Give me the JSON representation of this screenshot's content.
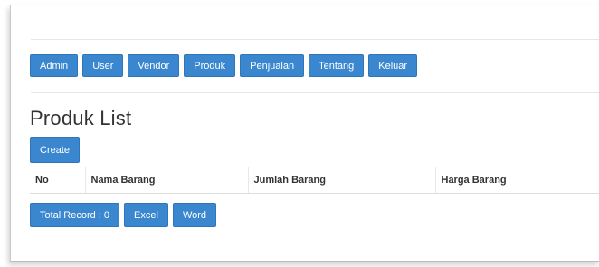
{
  "nav": {
    "items": [
      {
        "label": "Admin"
      },
      {
        "label": "User"
      },
      {
        "label": "Vendor"
      },
      {
        "label": "Produk"
      },
      {
        "label": "Penjualan"
      },
      {
        "label": "Tentang"
      },
      {
        "label": "Keluar"
      }
    ]
  },
  "page": {
    "title": "Produk List",
    "create_label": "Create"
  },
  "table": {
    "columns": [
      "No",
      "Nama Barang",
      "Jumlah Barang",
      "Harga Barang"
    ]
  },
  "footer": {
    "total_record_label": "Total Record : 0",
    "excel_label": "Excel",
    "word_label": "Word"
  },
  "colors": {
    "button": "#3a87d0",
    "button_text": "#ffffff",
    "title_text": "#333333"
  }
}
